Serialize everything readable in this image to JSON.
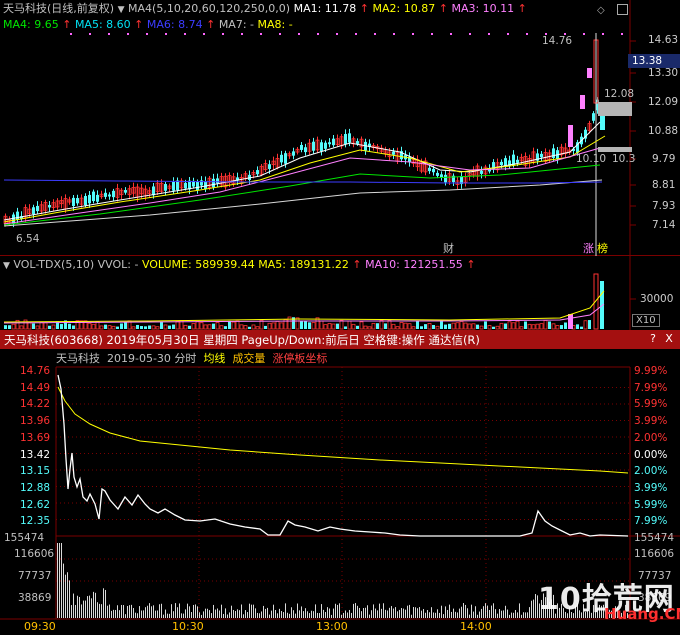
{
  "colors": {
    "bg": "#000000",
    "up": "#ff3232",
    "down": "#54fcfc",
    "ma1": "#ffffff",
    "ma2": "#ffff00",
    "ma3": "#ff80ff",
    "ma4": "#00e600",
    "ma5": "#02e2f4",
    "ma6": "#3c3cff",
    "grid": "#7a0000",
    "yellow": "#ffff00",
    "red": "#ff4040",
    "pink": "#ff80ff",
    "white": "#ffffff",
    "gray": "#c0c0c0",
    "gold": "#ffc000",
    "axis": "#c8c8c8"
  },
  "kline": {
    "title": "天马科技(日线,前复权)",
    "ma_params": "MA4(5,10,20,60,120,250,0,0)",
    "ma1": "MA1: 11.78",
    "ma2": "MA2: 10.87",
    "ma3": "MA3: 10.11",
    "ma4": "MA4: 9.65",
    "ma5": "MA5: 8.60",
    "ma6": "MA6: 8.74",
    "ma7": "MA7: -",
    "ma8": "MA8: -",
    "price_axis": [
      "14.63",
      "13.30",
      "12.09",
      "10.88",
      "9.79",
      "8.81",
      "7.93",
      "7.14"
    ],
    "current_price_tag": "13.38",
    "high_marker": "14.76",
    "low_marker": "6.54",
    "box_labels": [
      "12.08",
      "10.10",
      "10.3"
    ],
    "event_labels": [
      "财",
      "涨",
      "榜"
    ]
  },
  "volume": {
    "indicator": "VOL-TDX(5,10)",
    "vvol": "VVOL: -",
    "volume": "VOLUME: 589939.44",
    "ma5": "MA5: 189131.22",
    "ma10": "MA10: 121251.55",
    "axis_value": "30000",
    "unit": "X10"
  },
  "window": {
    "title": "天马科技(603668) 2019年05月30日 星期四 PageUp/Down:前后日 空格键:操作 通达信(R)",
    "help_icon": "?",
    "close_icon": "X"
  },
  "intraday": {
    "name": "天马科技",
    "date": "2019-05-30 分时",
    "avg_line": "均线",
    "vol": "成交量",
    "limit_coord": "涨停板坐标",
    "price_axis": [
      "14.76",
      "14.49",
      "14.22",
      "13.96",
      "13.69",
      "13.42",
      "13.15",
      "12.88",
      "12.62",
      "12.35",
      "155474"
    ],
    "pct_axis": [
      "9.99%",
      "7.99%",
      "5.99%",
      "3.99%",
      "2.00%",
      "0.00%",
      "2.00%",
      "3.99%",
      "5.99%",
      "7.99%",
      "155474"
    ],
    "vol_axis_left": [
      "116606",
      "77737",
      "38869"
    ],
    "vol_axis_right": [
      "116606",
      "77737",
      "38869"
    ],
    "time_axis": [
      "09:30",
      "10:30",
      "13:00",
      "14:00"
    ]
  },
  "watermark": {
    "brand": "10拾荒网",
    "url": "Huang.CN"
  },
  "icons": [
    "diamond-icon",
    "checkbox-icon",
    "help-icon",
    "close-icon",
    "dropdown-triangle-icon"
  ]
}
